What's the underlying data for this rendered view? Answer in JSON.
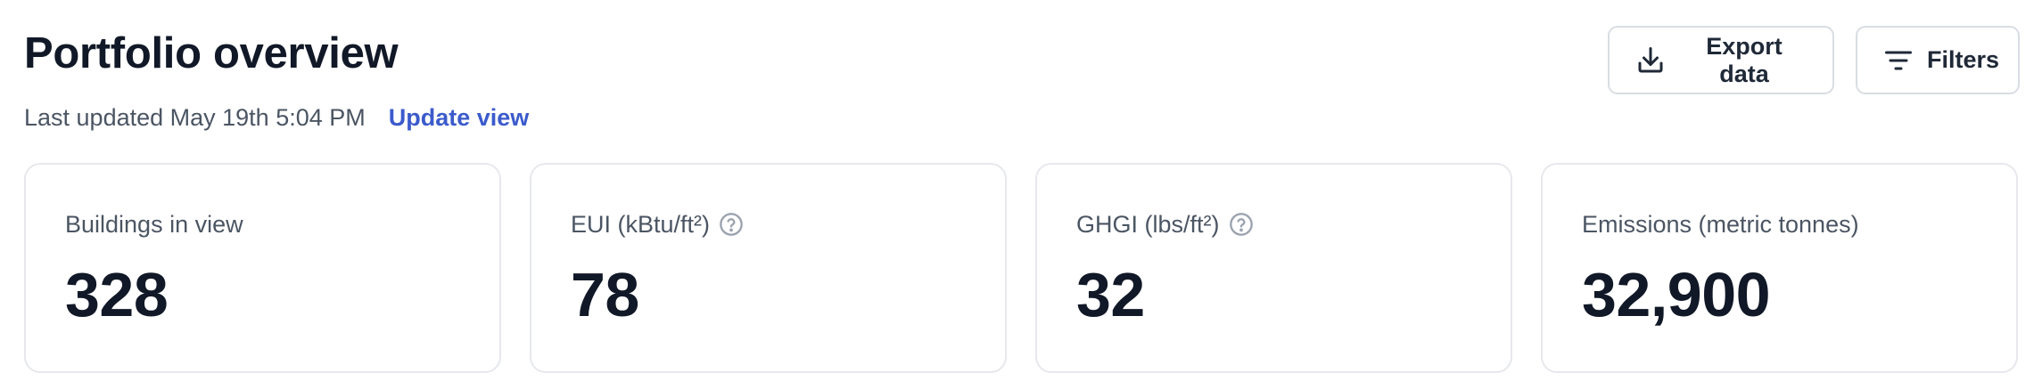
{
  "header": {
    "title": "Portfolio overview",
    "last_updated": "Last updated May 19th 5:04 PM",
    "update_link": "Update view"
  },
  "actions": {
    "export_label": "Export data",
    "export_icon": "download-icon",
    "filters_label": "Filters",
    "filters_icon": "filter-lines-icon"
  },
  "metrics": [
    {
      "label": "Buildings in view",
      "value": "328",
      "has_help": false
    },
    {
      "label": "EUI (kBtu/ft²)",
      "value": "78",
      "has_help": true
    },
    {
      "label": "GHGI (lbs/ft²)",
      "value": "32",
      "has_help": true
    },
    {
      "label": "Emissions (metric tonnes)",
      "value": "32,900",
      "has_help": false
    }
  ],
  "colors": {
    "link": "#3b5bcc",
    "text_primary": "#111827",
    "text_secondary": "#4b5563",
    "border": "#e6e8ec"
  }
}
